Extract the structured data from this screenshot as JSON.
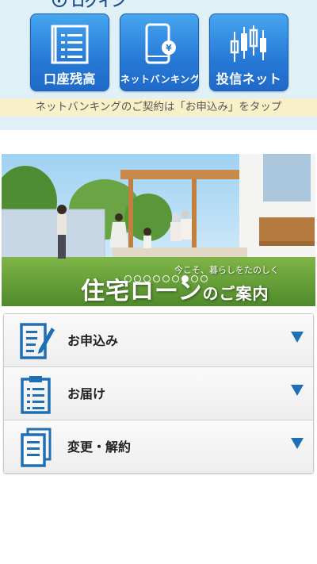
{
  "header": {
    "login_label": "ログイン"
  },
  "tiles": [
    {
      "label": "口座残高",
      "icon": "list-icon"
    },
    {
      "label": "ネットバンキング",
      "icon": "smartphone-yen-icon"
    },
    {
      "label": "投信ネット",
      "icon": "candlestick-chart-icon"
    }
  ],
  "notice": "ネットバンキングのご契約は「お申込み」をタップ",
  "banner": {
    "subtitle": "今こそ、暮らしをたのしく",
    "title_main": "住宅ローン",
    "title_tail": "のご案内",
    "carousel_total": 9,
    "carousel_active": 6
  },
  "menu": [
    {
      "label": "お申込み",
      "icon": "document-pen-icon"
    },
    {
      "label": "お届け",
      "icon": "clipboard-list-icon"
    },
    {
      "label": "変更・解約",
      "icon": "stacked-documents-icon"
    }
  ],
  "colors": {
    "top_bg": "#dff1f6",
    "tile_blue": "#2779d6",
    "notice_bg": "#f7f0c8",
    "icon_blue": "#1f6fb5"
  }
}
